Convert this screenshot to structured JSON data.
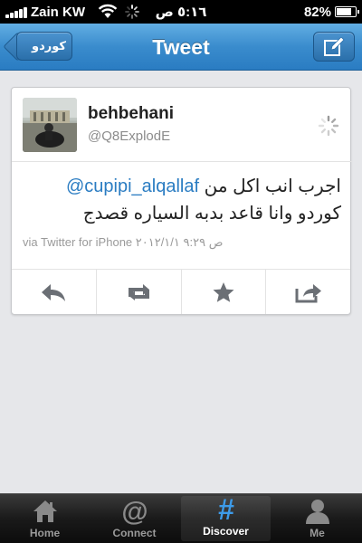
{
  "status_bar": {
    "carrier": "Zain KW",
    "time": "٥:١٦ ص",
    "battery": "82%",
    "battery_level": 0.82
  },
  "nav": {
    "back_label": "كوردو",
    "title": "Tweet"
  },
  "tweet": {
    "name": "behbehani",
    "handle": "@Q8ExplodE",
    "text_line1_prefix": "اجرب انب اكل من",
    "mention": "@cupipi_alqallaf",
    "text_line2": "كوردو وانا قاعد بدبه السياره قصدج",
    "meta": "via Twitter for iPhone ص ٩:٢٩ ٢٠١٢/١/١"
  },
  "actions": [
    {
      "icon": "reply-icon"
    },
    {
      "icon": "retweet-icon"
    },
    {
      "icon": "favorite-icon"
    },
    {
      "icon": "share-icon"
    }
  ],
  "tabs": [
    {
      "label": "Home",
      "icon": "home-icon",
      "active": false
    },
    {
      "label": "Connect",
      "icon": "at-icon",
      "active": false
    },
    {
      "label": "Discover",
      "icon": "hash-icon",
      "active": true
    },
    {
      "label": "Me",
      "icon": "person-icon",
      "active": false
    }
  ],
  "colors": {
    "nav_blue": "#3a8ccd",
    "link_blue": "#2a7cc2",
    "background": "#e6e7ea"
  }
}
